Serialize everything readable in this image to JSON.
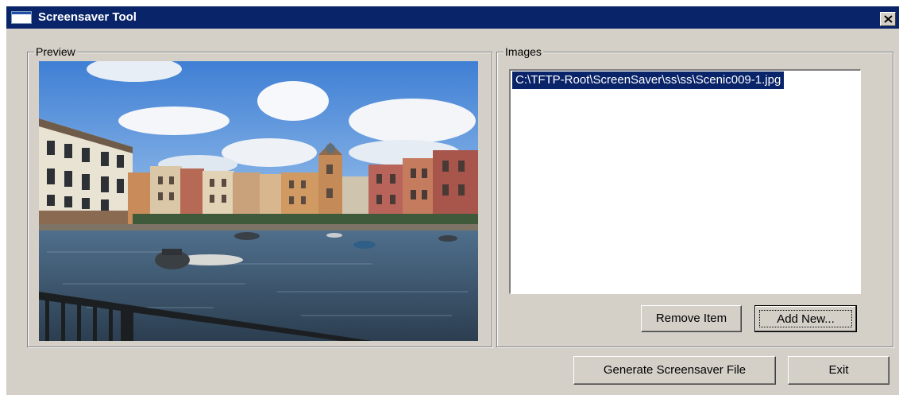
{
  "window": {
    "title": "Screensaver Tool",
    "close_symbol": "✕"
  },
  "preview": {
    "label": "Preview",
    "image": {
      "subject": "photo of a harbor with colorful Italian-style buildings, boats on the water, blue sky with clouds and a railing in the foreground"
    }
  },
  "images": {
    "label": "Images",
    "items": [
      {
        "path": "C:\\TFTP-Root\\ScreenSaver\\ss\\ss\\Scenic009-1.jpg",
        "selected": true
      }
    ]
  },
  "buttons": {
    "remove_label": "Remove Item",
    "add_label": "Add New...",
    "generate_label": "Generate Screensaver File",
    "exit_label": "Exit"
  },
  "colors": {
    "titlebar": "#0a246a",
    "face": "#d4d0c8",
    "selection": "#0a246a"
  }
}
